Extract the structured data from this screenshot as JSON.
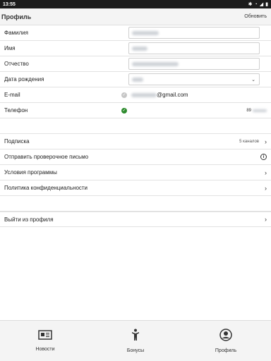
{
  "status": {
    "time": "13:55"
  },
  "header": {
    "title": "Профиль",
    "action": "Обновить"
  },
  "profile": {
    "lastname_label": "Фамилия",
    "firstname_label": "Имя",
    "patronymic_label": "Отчество",
    "birthdate_label": "Дата рождения",
    "email_label": "E-mail",
    "email_value_visible": "@gmail.com",
    "phone_label": "Телефон",
    "phone_value_visible": "89"
  },
  "menu": {
    "subscription_label": "Подписка",
    "subscription_meta": "5 каналов",
    "verify_email_label": "Отправить проверочное письмо",
    "terms_label": "Условия программы",
    "privacy_label": "Политика конфиденциальности",
    "logout_label": "Выйти из профиля"
  },
  "tabs": {
    "news": "Новости",
    "bonuses": "Бонусы",
    "profile": "Профиль"
  },
  "colors": {
    "verified": "#2e8b2e",
    "unverified": "#c6c6c6"
  },
  "icons": [
    "wifi-icon",
    "signal-icon",
    "battery-icon",
    "select-arrow-icon",
    "check-icon",
    "chevron-right-icon",
    "info-icon",
    "news-icon",
    "person-icon",
    "profile-icon"
  ]
}
